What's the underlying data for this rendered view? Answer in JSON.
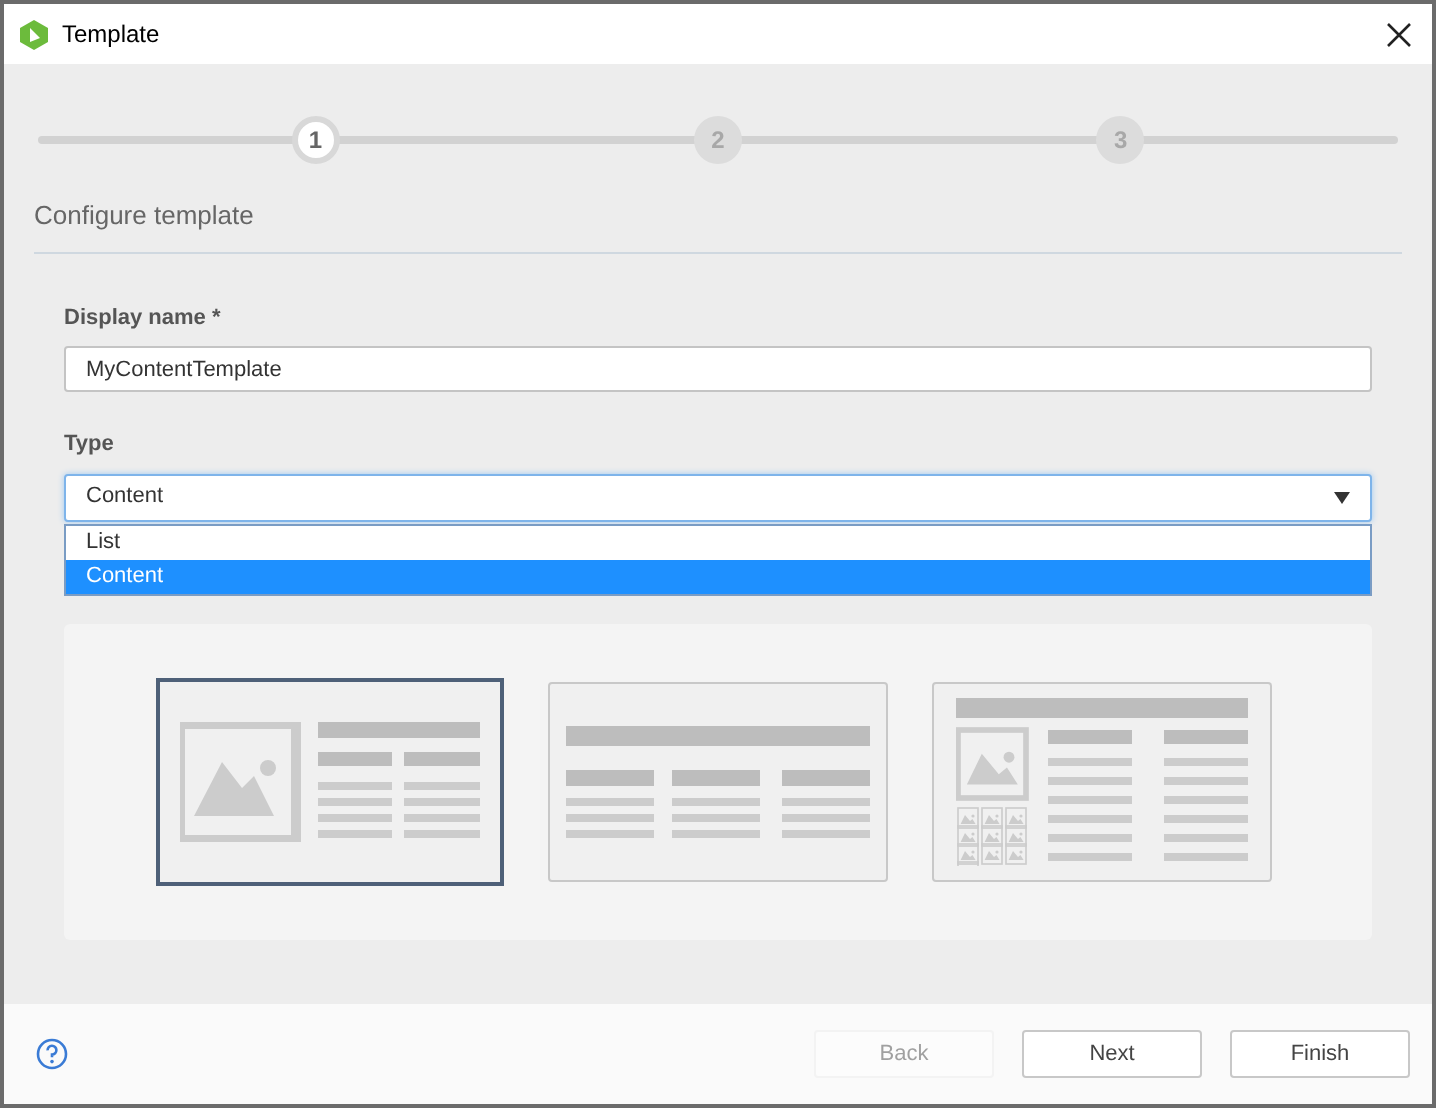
{
  "window": {
    "title": "Template"
  },
  "steps": [
    {
      "label": "1",
      "selected": true
    },
    {
      "label": "2",
      "selected": false
    },
    {
      "label": "3",
      "selected": false
    }
  ],
  "section_title": "Configure template",
  "display_name": {
    "label": "Display name *",
    "value": "MyContentTemplate"
  },
  "type": {
    "label": "Type",
    "value": "Content",
    "options": [
      {
        "label": "List",
        "selected": false
      },
      {
        "label": "Content",
        "selected": true
      }
    ]
  },
  "layouts": [
    {
      "kind": "image-columns",
      "selected": true
    },
    {
      "kind": "three-columns",
      "selected": false
    },
    {
      "kind": "gallery-columns",
      "selected": false
    }
  ],
  "buttons": [
    {
      "label": "Back",
      "disabled": true
    },
    {
      "label": "Next",
      "disabled": false
    },
    {
      "label": "Finish",
      "disabled": false
    }
  ]
}
